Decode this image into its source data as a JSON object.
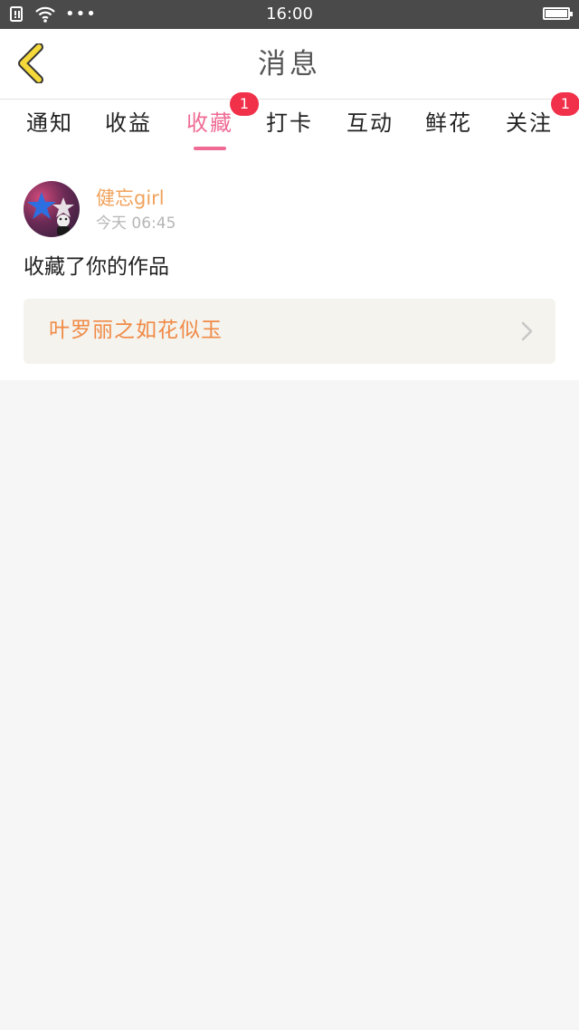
{
  "status_bar": {
    "time": "16:00",
    "dots": "•••",
    "battery_level": 1.0,
    "icons": [
      "notification-icon",
      "wifi-icon",
      "battery-icon"
    ]
  },
  "header": {
    "title": "消息",
    "back_icon": "chevron-left-icon"
  },
  "tabs": [
    {
      "label": "通知",
      "badge": ""
    },
    {
      "label": "收益",
      "badge": ""
    },
    {
      "label": "收藏",
      "badge": "1",
      "active": true
    },
    {
      "label": "打卡",
      "badge": ""
    },
    {
      "label": "互动",
      "badge": ""
    },
    {
      "label": "鲜花",
      "badge": ""
    },
    {
      "label": "关注",
      "badge": "1"
    }
  ],
  "message": {
    "username": "健忘girl",
    "time": "今天 06:45",
    "action": "收藏了你的作品",
    "work_title": "叶罗丽之如花似玉"
  },
  "colors": {
    "accent": "#ef6b95",
    "badge": "#f1304a",
    "username": "#f0a25c",
    "work_title": "#f08a46",
    "back_icon": "#f5d93a"
  }
}
